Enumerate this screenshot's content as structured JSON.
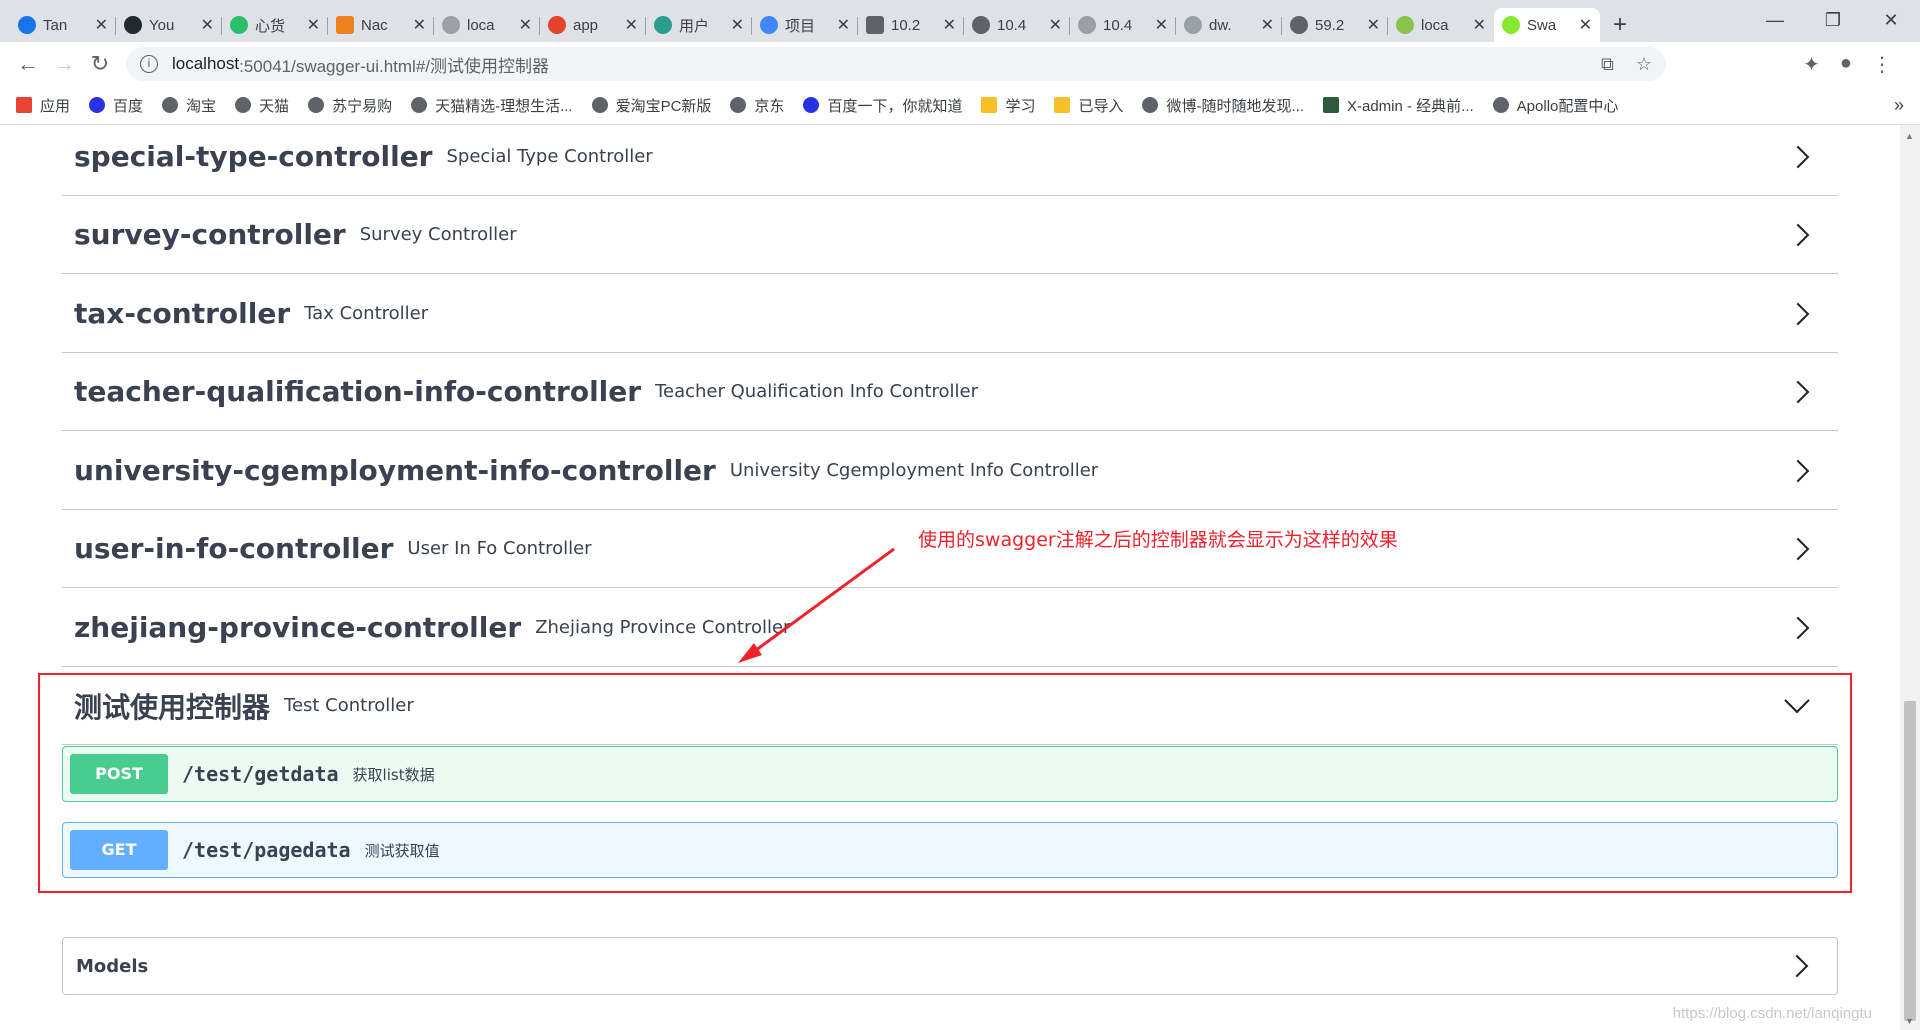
{
  "browser": {
    "tabs": [
      {
        "label": "Tan",
        "color": "#1a73e8"
      },
      {
        "label": "You",
        "color": "#24292e"
      },
      {
        "label": "心货",
        "color": "#2bbf6b"
      },
      {
        "label": "Nac",
        "color": "#f0801d"
      },
      {
        "label": "loca",
        "color": "#9aa0a6"
      },
      {
        "label": "app",
        "color": "#e24329"
      },
      {
        "label": "用户",
        "color": "#2a9d8f"
      },
      {
        "label": "项目",
        "color": "#4285f4"
      },
      {
        "label": "10.2",
        "color": "#5f6368"
      },
      {
        "label": "10.4",
        "color": "#5f6368"
      },
      {
        "label": "10.4",
        "color": "#9aa0a6"
      },
      {
        "label": "dw.",
        "color": "#9aa0a6"
      },
      {
        "label": "59.2",
        "color": "#5f6368"
      },
      {
        "label": "loca",
        "color": "#8bc34a"
      },
      {
        "label": "Swa",
        "color": "#85ea2d"
      }
    ],
    "new_tab": "+",
    "window_controls": {
      "minimize": "—",
      "maximize": "❐",
      "close": "✕"
    },
    "url_host": "localhost",
    "url_path": ":50041/swagger-ui.html#/测试使用控制器",
    "bookmarks": [
      {
        "label": "应用",
        "color": "#ea4335"
      },
      {
        "label": "百度",
        "color": "#2932e1"
      },
      {
        "label": "淘宝",
        "color": "#5f6368"
      },
      {
        "label": "天猫",
        "color": "#5f6368"
      },
      {
        "label": "苏宁易购",
        "color": "#5f6368"
      },
      {
        "label": "天猫精选-理想生活...",
        "color": "#5f6368"
      },
      {
        "label": "爱淘宝PC新版",
        "color": "#5f6368"
      },
      {
        "label": "京东",
        "color": "#5f6368"
      },
      {
        "label": "百度一下，你就知道",
        "color": "#2932e1"
      },
      {
        "label": "学习",
        "color": "#f6c026"
      },
      {
        "label": "已导入",
        "color": "#f6c026"
      },
      {
        "label": "微博-随时随地发现...",
        "color": "#5f6368"
      },
      {
        "label": "X-admin - 经典前...",
        "color": "#2d5a3d"
      },
      {
        "label": "Apollo配置中心",
        "color": "#5f6368"
      }
    ],
    "bookmarks_more": "»"
  },
  "swagger": {
    "tags": [
      {
        "name": "special-type-controller",
        "desc": "Special Type Controller"
      },
      {
        "name": "survey-controller",
        "desc": "Survey Controller"
      },
      {
        "name": "tax-controller",
        "desc": "Tax Controller"
      },
      {
        "name": "teacher-qualification-info-controller",
        "desc": "Teacher Qualification Info Controller"
      },
      {
        "name": "university-cgemployment-info-controller",
        "desc": "University Cgemployment Info Controller"
      },
      {
        "name": "user-in-fo-controller",
        "desc": "User In Fo Controller"
      },
      {
        "name": "zhejiang-province-controller",
        "desc": "Zhejiang Province Controller"
      }
    ],
    "expanded_tag": {
      "name": "测试使用控制器",
      "desc": "Test Controller"
    },
    "operations": [
      {
        "method": "POST",
        "path": "/test/getdata",
        "summary": "获取list数据"
      },
      {
        "method": "GET",
        "path": "/test/pagedata",
        "summary": "测试获取值"
      }
    ],
    "models_label": "Models"
  },
  "annotation": "使用的swagger注解之后的控制器就会显示为这样的效果",
  "watermark": "https://blog.csdn.net/lanqingtu"
}
